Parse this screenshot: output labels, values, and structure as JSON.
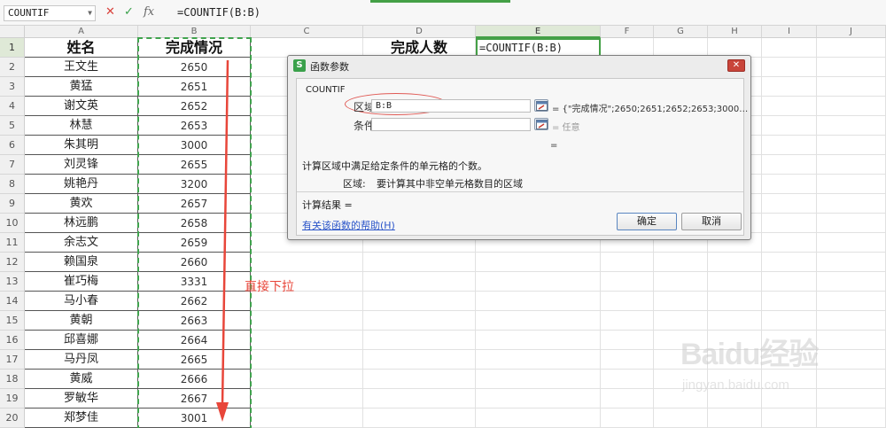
{
  "formula_bar": {
    "name_box": "COUNTIF",
    "cancel_icon": "✕",
    "enter_icon": "✓",
    "fx_label": "fx",
    "formula": "=COUNTIF(B:B)"
  },
  "sheet": {
    "columns": [
      "A",
      "B",
      "C",
      "D",
      "E",
      "F",
      "G",
      "H",
      "I",
      "J"
    ],
    "rows": [
      "1",
      "2",
      "3",
      "4",
      "5",
      "6",
      "7",
      "8",
      "9",
      "10",
      "11",
      "12",
      "13",
      "14",
      "15",
      "16",
      "17",
      "18",
      "19",
      "20"
    ],
    "header_name": "姓名",
    "header_status": "完成情况",
    "d1_label": "完成人数",
    "e1_formula": "=COUNTIF(B:B)",
    "records": [
      {
        "name": "王文生",
        "value": "2650"
      },
      {
        "name": "黄猛",
        "value": "2651"
      },
      {
        "name": "谢文英",
        "value": "2652"
      },
      {
        "name": "林慧",
        "value": "2653"
      },
      {
        "name": "朱其明",
        "value": "3000"
      },
      {
        "name": "刘灵锋",
        "value": "2655"
      },
      {
        "name": "姚艳丹",
        "value": "3200"
      },
      {
        "name": "黄欢",
        "value": "2657"
      },
      {
        "name": "林远鹏",
        "value": "2658"
      },
      {
        "name": "余志文",
        "value": "2659"
      },
      {
        "name": "赖国泉",
        "value": "2660"
      },
      {
        "name": "崔巧梅",
        "value": "3331"
      },
      {
        "name": "马小春",
        "value": "2662"
      },
      {
        "name": "黄朝",
        "value": "2663"
      },
      {
        "name": "邱喜娜",
        "value": "2664"
      },
      {
        "name": "马丹凤",
        "value": "2665"
      },
      {
        "name": "黄威",
        "value": "2666"
      },
      {
        "name": "罗敏华",
        "value": "2667"
      },
      {
        "name": "郑梦佳",
        "value": "3001"
      }
    ]
  },
  "annotation": {
    "drag_text": "直接下拉",
    "color": "#e8463a"
  },
  "dialog": {
    "logo": "S",
    "title": "函数参数",
    "close_icon": "✕",
    "function_name": "COUNTIF",
    "arg1_label": "区域",
    "arg1_value": "B:B",
    "arg1_result": "= {\"完成情况\";2650;2651;2652;2653;3000…",
    "arg2_label": "条件",
    "arg2_value": "",
    "arg2_result": "= 任意",
    "result_eq": "=",
    "description": "计算区域中满足给定条件的单元格的个数。",
    "arg_desc_label": "区域:",
    "arg_desc_text": "要计算其中非空单元格数目的区域",
    "calc_result": "计算结果 =",
    "help_link": "有关该函数的帮助(H)",
    "ok_label": "确定",
    "cancel_label": "取消"
  },
  "watermark": {
    "logo_text": "Baidu经验",
    "sub_text": "jingyan.baidu.com"
  },
  "colors": {
    "accent_green": "#44a046",
    "dash_green": "#3fa34d",
    "link_blue": "#2b55c9",
    "close_red": "#c9453a"
  }
}
